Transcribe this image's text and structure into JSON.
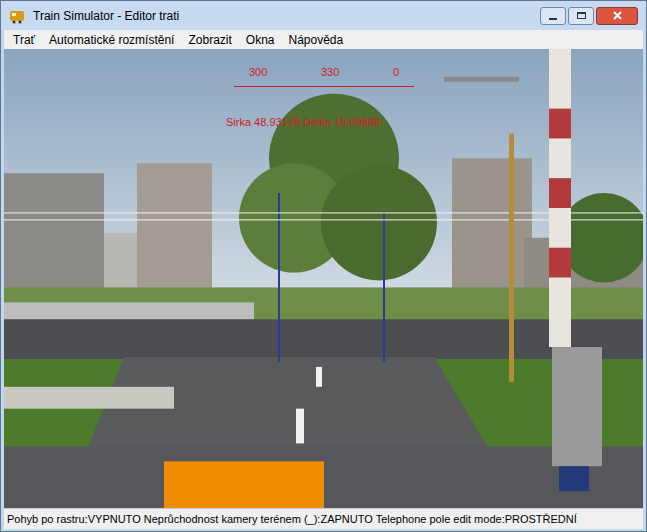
{
  "window": {
    "title": "Train Simulator - Editor trati"
  },
  "menu": [
    "Trať",
    "Automatické rozmístění",
    "Zobrazit",
    "Okna",
    "Nápověda"
  ],
  "viewport": {
    "compass": [
      "300",
      "330",
      "0"
    ],
    "coordinates": "Sirka 48.93138 Delka 18.09888"
  },
  "status_bar": "Pohyb po rastru:VYPNUTO Neprůchodnost kamery terénem (_):ZAPNUTO Telephone pole edit mode:PROSTŘEDNÍ"
}
